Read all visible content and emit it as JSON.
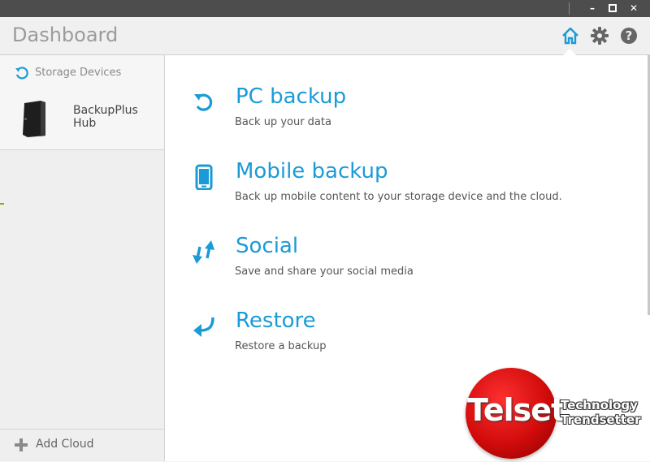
{
  "window": {
    "controls": {
      "minimize": "–",
      "maximize": "□",
      "close": "✕"
    }
  },
  "header": {
    "title": "Dashboard",
    "icons": [
      "home-icon",
      "gear-icon",
      "help-icon"
    ],
    "accent_color": "#1a9bd7"
  },
  "sidebar": {
    "section_label": "Storage Devices",
    "devices": [
      {
        "label": "BackupPlus Hub",
        "icon": "external-drive-icon"
      }
    ],
    "add_cloud_label": "Add Cloud"
  },
  "main": {
    "items": [
      {
        "title": "PC backup",
        "description": "Back up your data",
        "icon": "backup-icon"
      },
      {
        "title": "Mobile backup",
        "description": "Back up mobile content to your storage device and the cloud.",
        "icon": "mobile-icon"
      },
      {
        "title": "Social",
        "description": "Save and share your social media",
        "icon": "transfer-arrows-icon"
      },
      {
        "title": "Restore",
        "description": "Restore a backup",
        "icon": "restore-arrow-icon"
      }
    ]
  },
  "watermark": {
    "brand": "Telset",
    "tagline_1": "Technology",
    "tagline_2": "Trendsetter"
  }
}
